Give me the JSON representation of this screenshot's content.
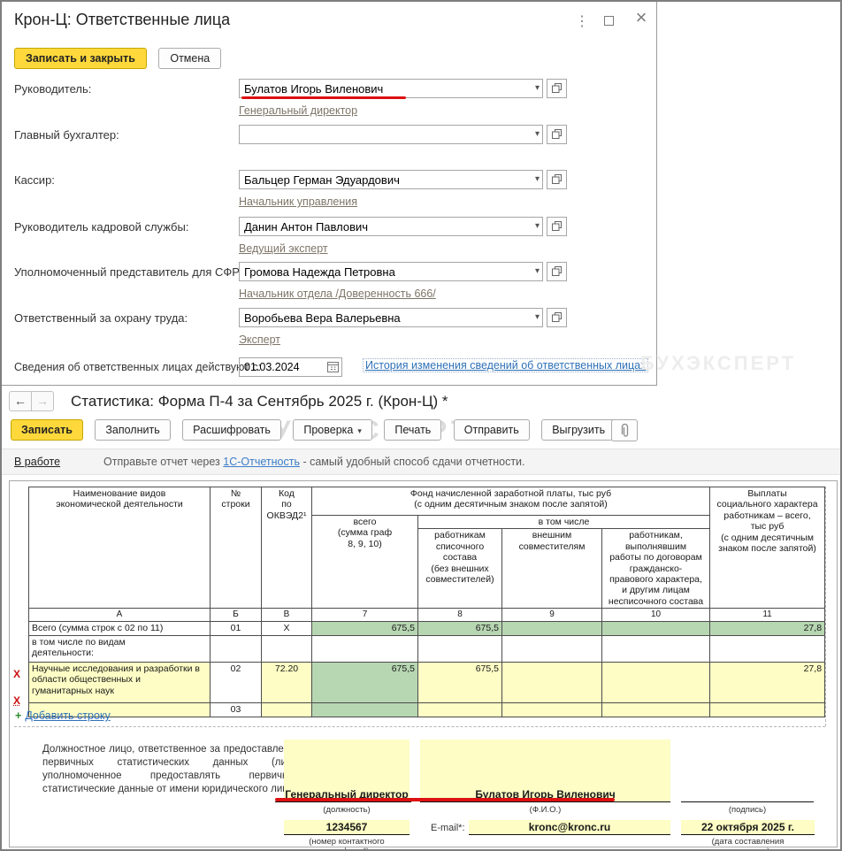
{
  "icons": {
    "menu": "⋮",
    "close": "×",
    "back": "←",
    "forward": "→",
    "dropdown": "▾",
    "add": "+",
    "delete_row": "X"
  },
  "colors": {
    "accent_yellow": "#ffd93c",
    "cell_green": "#b7d6b2",
    "cell_yellow": "#fdfdc5",
    "annotation_red": "#dd1111",
    "link_blue": "#2e71b8",
    "link_gray": "#7d7567"
  },
  "watermark": "БУХЭКСПЕРТ",
  "window1": {
    "title": "Крон-Ц: Ответственные лица",
    "buttons": {
      "save_close": "Записать и закрыть",
      "cancel": "Отмена"
    },
    "fields": [
      {
        "label": "Руководитель:",
        "value": "Булатов Игорь Виленович",
        "position_link": "Генеральный директор"
      },
      {
        "label": "Главный бухгалтер:",
        "value": "",
        "position_link": ""
      },
      {
        "label": "Кассир:",
        "value": "Бальцер Герман Эдуардович",
        "position_link": "Начальник управления"
      },
      {
        "label": "Руководитель кадровой службы:",
        "value": "Данин Антон Павлович",
        "position_link": "Ведущий эксперт"
      },
      {
        "label": "Уполномоченный представитель для СФР:",
        "value": "Громова Надежда Петровна",
        "position_link": "Начальник отдела  /Доверенность 666/"
      },
      {
        "label": "Ответственный за охрану труда:",
        "value": "Воробьева Вера Валерьевна",
        "position_link": "Эксперт"
      }
    ],
    "valid_from": {
      "label": "Сведения об ответственных лицах действуют с:",
      "date": "01.03.2024",
      "history_link": "История изменения сведений об ответственных лицах"
    }
  },
  "window2": {
    "title": "Статистика: Форма П-4 за Сентябрь 2025 г. (Крон-Ц) *",
    "toolbar": {
      "save": "Записать",
      "fill": "Заполнить",
      "decode": "Расшифровать",
      "check": "Проверка",
      "print": "Печать",
      "send": "Отправить",
      "export": "Выгрузить"
    },
    "status": {
      "state": "В работе",
      "message_before": "Отправьте отчет через ",
      "link": "1С-Отчетность",
      "message_after": " - самый удобный способ сдачи отчетности."
    },
    "table": {
      "header": {
        "col_a": "Наименование видов\nэкономической деятельности",
        "col_b": "№\nстроки",
        "col_v": "Код\nпо\nОКВЭД2¹",
        "fund": "Фонд начисленной заработной платы, тыс руб\n(с одним десятичным знаком после запятой)",
        "col_7": "всего\n(сумма граф\n8, 9, 10)",
        "incl": "в том числе",
        "col_8": "работникам\nсписочного состава\n(без внешних\nсовместителей)",
        "col_9": "внешним\nсовместителям",
        "col_10": "работникам,\nвыполнявшим\nработы по договорам\nгражданско-\nправового характера,\nи другим лицам\nнесписочного состава",
        "col_11": "Выплаты\nсоциального характера\nработникам – всего,\nтыс руб\n(с одним десятичным\nзнаком после запятой)"
      },
      "letters": [
        "А",
        "Б",
        "В",
        "7",
        "8",
        "9",
        "10",
        "11"
      ],
      "rows": [
        {
          "cells": [
            "Всего (сумма строк с 02 по 11)",
            "01",
            "Х",
            "675,5",
            "675,5",
            "",
            "",
            "27,8"
          ]
        },
        {
          "cells": [
            "в том числе по видам\nдеятельности:",
            "",
            "",
            "",
            "",
            "",
            "",
            ""
          ]
        },
        {
          "cells": [
            "Научные исследования и разработки в\nобласти общественных и\nгуманитарных наук",
            "02",
            "72.20",
            "675,5",
            "675,5",
            "",
            "",
            "27,8"
          ]
        },
        {
          "cells": [
            "",
            "03",
            "",
            "",
            "",
            "",
            "",
            ""
          ]
        }
      ],
      "add_row_link": "Добавить строку"
    },
    "footer": {
      "responsible_text": "Должностное лицо, ответственное за предоставление первичных статистических данных (лицо, уполномоченное предоставлять первичные статистические данные от имени юридического лица)",
      "position": "Генеральный директор",
      "position_caption": "(должность)",
      "fio": "Булатов Игорь Виленович",
      "fio_caption": "(Ф.И.О.)",
      "signature_caption": "(подпись)",
      "phone": "1234567",
      "phone_caption": "(номер контактного\nтелефона*)",
      "email_label": "E-mail*:",
      "email": "kronc@kronc.ru",
      "doc_date": "22 октября 2025 г.",
      "doc_date_caption": "(дата составления\nдокумента)"
    }
  }
}
